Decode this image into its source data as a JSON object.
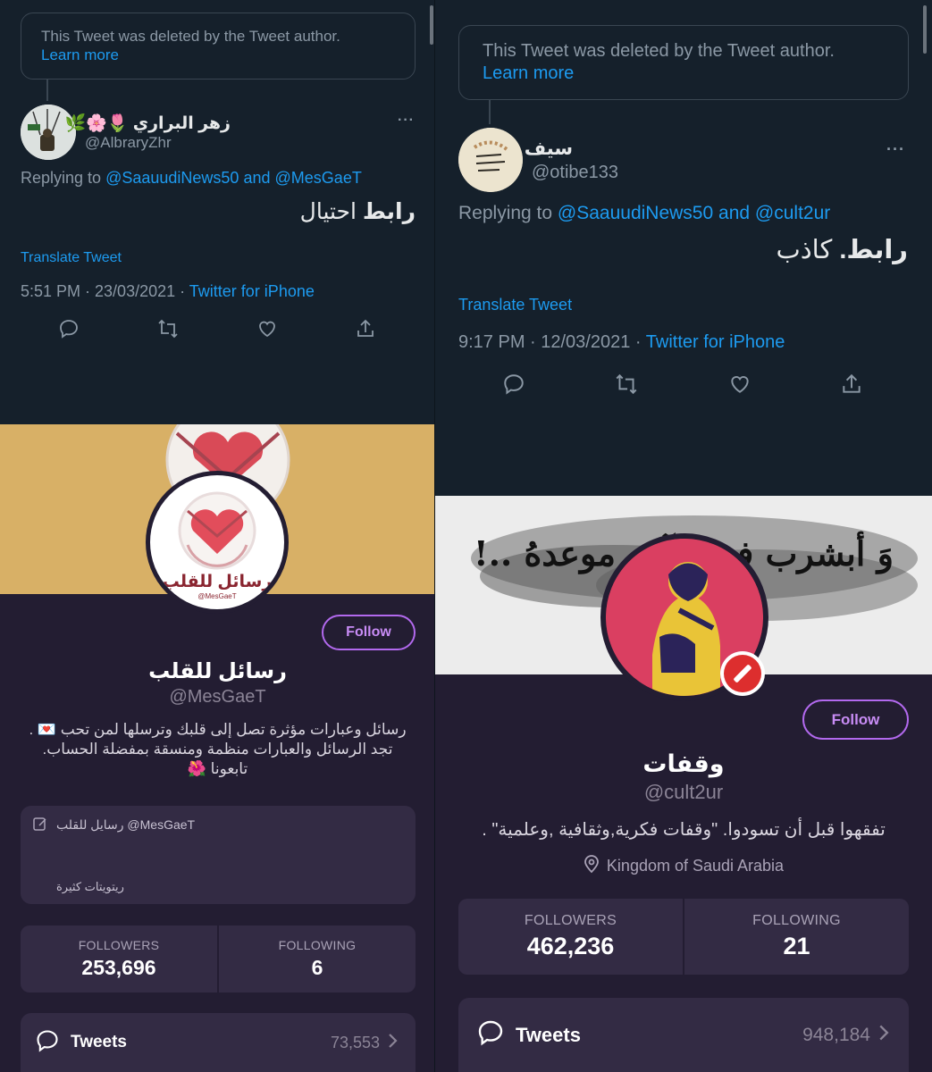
{
  "left": {
    "deleted_notice": "This Tweet was deleted by the Tweet author.",
    "learn_more": "Learn more",
    "tweet": {
      "name": "زهر البراري",
      "emojis": "🌷🌸🌿",
      "handle": "@AlbraryZhr",
      "replying_prefix": "Replying to",
      "mention1": "@SaauudiNews50",
      "and": "and",
      "mention2": "@MesGaeT",
      "text_bold": "رابط",
      "text_rest": " احتيال",
      "translate": "Translate Tweet",
      "time": "5:51 PM · 23/03/2021 · ",
      "source": "Twitter for iPhone"
    },
    "profile": {
      "banner_color": "#d8b066",
      "avatar_caption": "رسائل للقلب",
      "avatar_caption_small": "@MesGaeT",
      "follow_label": "Follow",
      "name": "رسائل للقلب",
      "handle": "@MesGaeT",
      "bio_line1": "رسائل وعبارات مؤثرة تصل إلى قلبك وترسلها لمن تحب 💌 .",
      "bio_line2": "تجد الرسائل والعبارات منظمة ومنسقة بمفضلة الحساب.",
      "bio_line3": "تابعونا 🌺",
      "card_title": "رسايل للقلب @MesGaeT",
      "card_sub": "ريتويتات كثيرة",
      "followers_label": "FOLLOWERS",
      "followers": "253,696",
      "following_label": "FOLLOWING",
      "following": "6",
      "tweets_label": "Tweets",
      "tweets_count": "73,553"
    }
  },
  "right": {
    "deleted_notice": "This Tweet was deleted by the Tweet author.",
    "learn_more": "Learn more",
    "tweet": {
      "name": "سيف",
      "handle": "@otibe133",
      "replying_prefix": "Replying to",
      "mention1": "@SaauudiNews50",
      "and": "and",
      "mention2": "@cult2ur",
      "text_bold": "رابط.",
      "text_rest": " كاذب",
      "translate": "Translate Tweet",
      "time": "9:17 PM · 12/03/2021 · ",
      "source": "Twitter for iPhone"
    },
    "profile": {
      "banner_text": "وَ أبشرب فـ ـيـ آ ن موعدهُ ..!",
      "follow_label": "Follow",
      "name": "وقفات",
      "handle": "@cult2ur",
      "bio": "تفقهوا قبل أن تسودوا. \"وقفات فكرية,وثقافية ,وعلمية\" .",
      "location": "Kingdom of Saudi Arabia",
      "followers_label": "FOLLOWERS",
      "followers": "462,236",
      "following_label": "FOLLOWING",
      "following": "21",
      "tweets_label": "Tweets",
      "tweets_count": "948,184"
    }
  },
  "icons": {
    "more": "more-dots-icon",
    "reply": "reply-bubble-icon",
    "retweet": "retweet-icon",
    "like": "heart-icon",
    "share": "share-icon",
    "card": "compose-icon",
    "location": "location-pin-icon",
    "blocked": "blocked-badge-icon",
    "tweets": "speech-bubble-icon",
    "chevron": "chevron-right-icon"
  }
}
